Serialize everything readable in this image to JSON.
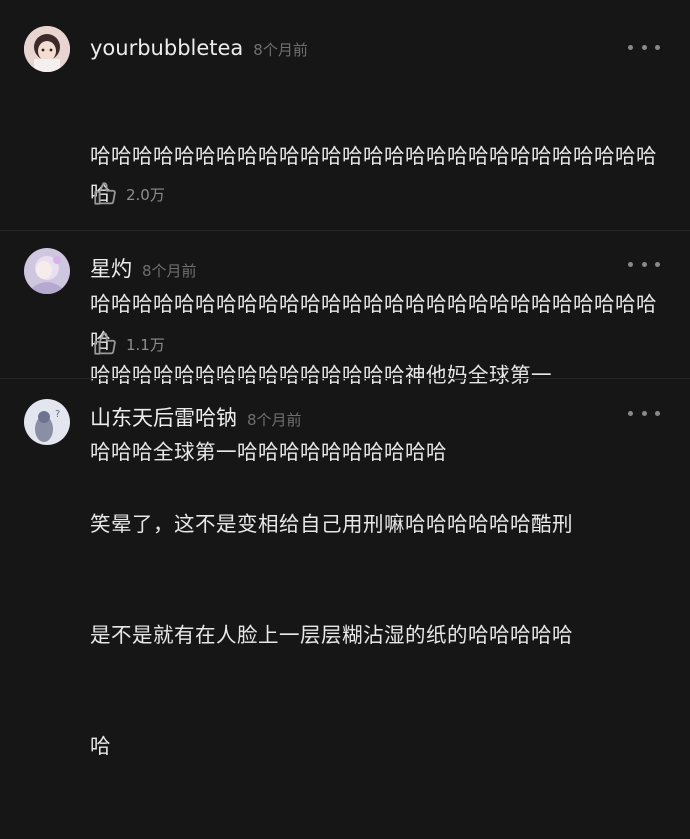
{
  "comments": [
    {
      "username": "yourbubbletea",
      "time": "8个月前",
      "lines": [
        "哈哈哈哈哈哈哈哈哈哈哈哈哈哈哈哈哈哈哈哈哈哈哈哈哈哈哈哈",
        "哈哈哈哈哈哈哈哈哈哈哈哈哈哈哈哈哈哈哈哈哈哈哈哈哈哈哈哈",
        "哈哈哈全球第一哈哈哈哈哈哈哈哈哈哈"
      ],
      "likes": "2.0万",
      "avatar_icon": "girl-avatar-icon"
    },
    {
      "username": "星灼",
      "time": "8个月前",
      "lines": [
        "哈哈哈哈哈哈哈哈哈哈哈哈哈哈哈神他妈全球第一"
      ],
      "likes": "1.1万",
      "avatar_icon": "anime-avatar-icon"
    },
    {
      "username": "山东天后雷哈钠",
      "time": "8个月前",
      "lines": [
        "笑晕了，这不是变相给自己用刑嘛哈哈哈哈哈哈酷刑",
        "是不是就有在人脸上一层层糊沾湿的纸的哈哈哈哈哈",
        "哈"
      ],
      "likes": "",
      "avatar_icon": "cartoon-avatar-icon"
    }
  ],
  "icons": {
    "more": "more-dots-icon",
    "like": "thumbs-up-icon"
  },
  "colors": {
    "background": "#161616",
    "text": "#e8e8e8",
    "muted": "#6f6f6f"
  }
}
